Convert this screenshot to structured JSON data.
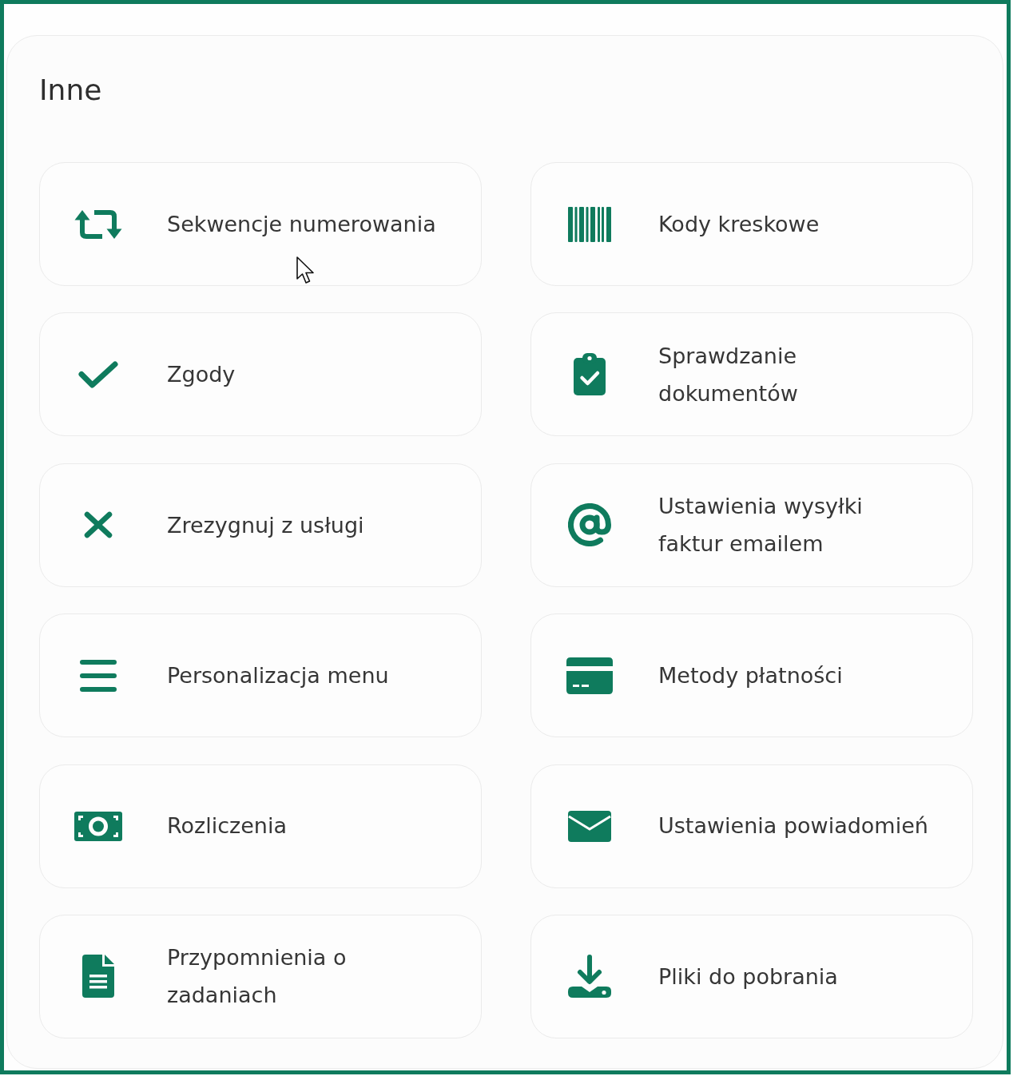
{
  "section": {
    "title": "Inne"
  },
  "tiles": [
    {
      "label": "Sekwencje numerowania"
    },
    {
      "label": "Zgody"
    },
    {
      "label": "Zrezygnuj z usługi"
    },
    {
      "label": "Personalizacja menu"
    },
    {
      "label": "Rozliczenia"
    },
    {
      "label": "Przypomnienia o zadaniach"
    },
    {
      "label": "Kody kreskowe"
    },
    {
      "label": "Sprawdzanie dokumentów"
    },
    {
      "label": "Ustawienia wysyłki faktur emailem"
    },
    {
      "label": "Metody płatności"
    },
    {
      "label": "Ustawienia powiadomień"
    },
    {
      "label": "Pliki do pobrania"
    }
  ]
}
